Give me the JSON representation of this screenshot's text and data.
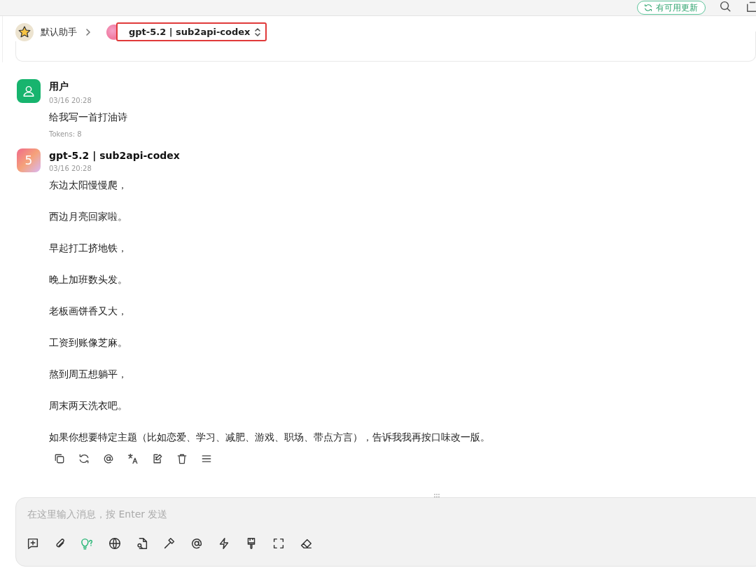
{
  "top_bar": {
    "update_button": "有可用更新"
  },
  "header": {
    "assistant": "默认助手",
    "model": "gpt-5.2 | sub2api-codex",
    "model_highlighted": true
  },
  "messages": [
    {
      "kind": "user",
      "author": "用户",
      "time": "03/16 20:28",
      "paragraphs": [
        "给我写一首打油诗"
      ],
      "tokens": "Tokens: 8"
    },
    {
      "kind": "assistant",
      "author": "gpt-5.2 | sub2api-codex",
      "avatar_text": "5",
      "time": "03/16 20:28",
      "paragraphs": [
        "东边太阳慢慢爬，",
        "西边月亮回家啦。",
        "早起打工挤地铁，",
        "晚上加班数头发。",
        "老板画饼香又大，",
        "工资到账像芝麻。",
        "熬到周五想躺平，",
        "周末两天洗衣吧。",
        "如果你想要特定主题（比如恋爱、学习、减肥、游戏、职场、带点方言），告诉我我再按口味改一版。"
      ],
      "actions": [
        {
          "kind": "copy"
        },
        {
          "kind": "regenerate"
        },
        {
          "kind": "mention"
        },
        {
          "kind": "translate"
        },
        {
          "kind": "edit"
        },
        {
          "kind": "delete"
        },
        {
          "kind": "menu"
        }
      ]
    }
  ],
  "input": {
    "placeholder": "在这里输入消息，按 Enter 发送",
    "tools": [
      {
        "kind": "new-topic",
        "active": false
      },
      {
        "kind": "attach",
        "active": false
      },
      {
        "kind": "thinking",
        "active": true
      },
      {
        "kind": "web",
        "active": false
      },
      {
        "kind": "knowledge",
        "active": false
      },
      {
        "kind": "tools",
        "active": false
      },
      {
        "kind": "mention",
        "active": false
      },
      {
        "kind": "quick",
        "active": false
      },
      {
        "kind": "paint",
        "active": false
      },
      {
        "kind": "expand",
        "active": false
      },
      {
        "kind": "clear",
        "active": false
      }
    ]
  }
}
